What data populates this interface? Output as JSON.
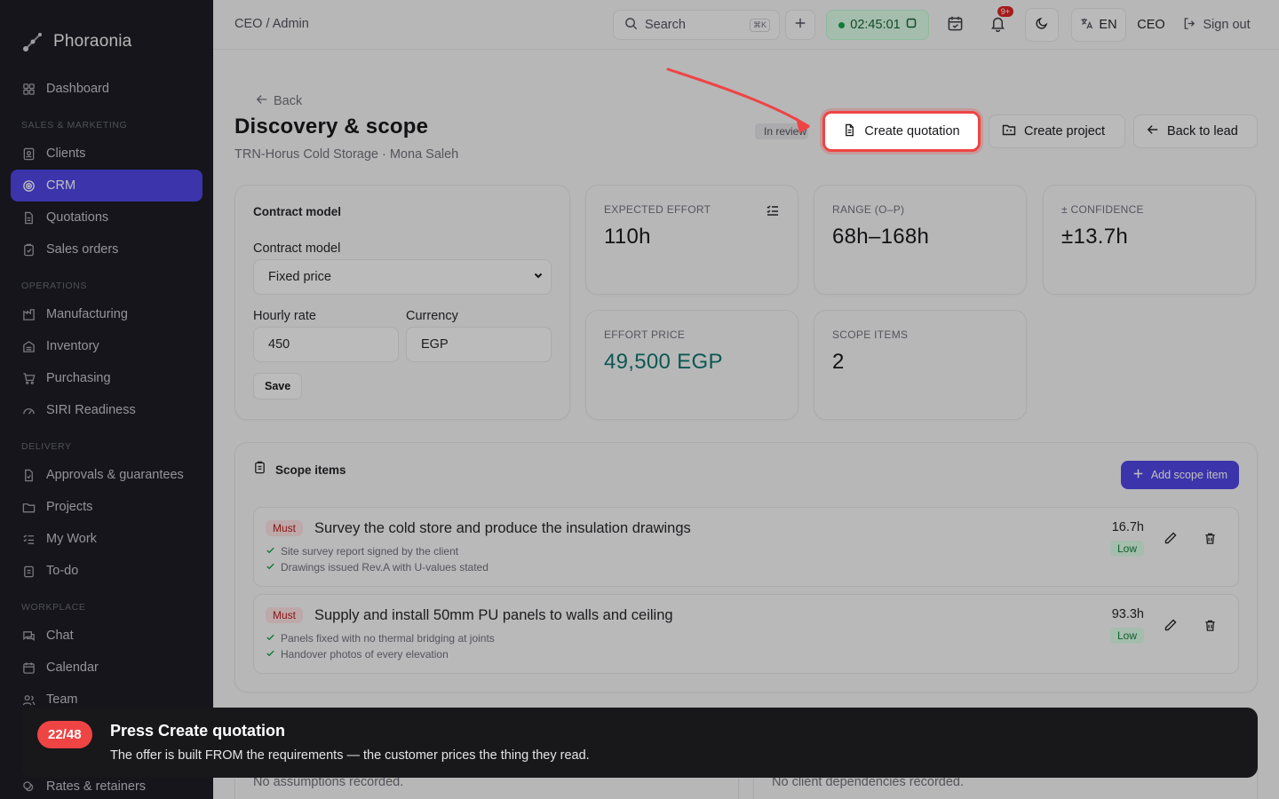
{
  "brand": {
    "name": "Phoraonia"
  },
  "sidebar": {
    "dashboard": "Dashboard",
    "sections": {
      "sales": "SALES & MARKETING",
      "operations": "OPERATIONS",
      "delivery": "DELIVERY",
      "workplace": "WORKPLACE"
    },
    "items": {
      "clients": "Clients",
      "crm": "CRM",
      "quotations": "Quotations",
      "sales_orders": "Sales orders",
      "manufacturing": "Manufacturing",
      "inventory": "Inventory",
      "purchasing": "Purchasing",
      "siri": "SIRI Readiness",
      "approvals": "Approvals & guarantees",
      "projects": "Projects",
      "mywork": "My Work",
      "todo": "To-do",
      "chat": "Chat",
      "calendar": "Calendar",
      "team": "Team",
      "rates": "Rates & retainers"
    }
  },
  "topbar": {
    "breadcrumb": "CEO / Admin",
    "search_label": "Search",
    "search_kbd": "⌘K",
    "timer": "02:45:01",
    "notif_badge": "9+",
    "language": "EN",
    "role": "CEO",
    "signout": "Sign out"
  },
  "page": {
    "back": "Back",
    "title": "Discovery & scope",
    "subtitle": "TRN-Horus Cold Storage · Mona Saleh",
    "status": "In review",
    "btn_quote": "Create quotation",
    "btn_project": "Create project",
    "btn_lead": "Back to lead"
  },
  "contract": {
    "heading": "Contract model",
    "model_label": "Contract model",
    "model_value": "Fixed price",
    "rate_label": "Hourly rate",
    "rate_value": "450",
    "currency_label": "Currency",
    "currency_value": "EGP",
    "save": "Save"
  },
  "stats": {
    "effort_label": "EXPECTED EFFORT",
    "effort_value": "110h",
    "range_label": "RANGE (O–P)",
    "range_value": "68h–168h",
    "confidence_label": "± CONFIDENCE",
    "confidence_value": "±13.7h",
    "price_label": "EFFORT PRICE",
    "price_value": "49,500 EGP",
    "items_label": "SCOPE ITEMS",
    "items_value": "2"
  },
  "colors": {
    "accent": "#4f46e5",
    "highlight": "#ef4444",
    "price": "#0f766e"
  },
  "scope": {
    "heading": "Scope items",
    "add": "Add scope item",
    "items": [
      {
        "priority": "Must",
        "title": "Survey the cold store and produce the insulation drawings",
        "criteria": [
          "Site survey report signed by the client",
          "Drawings issued Rev.A with U-values stated"
        ],
        "hours": "16.7h",
        "risk": "Low"
      },
      {
        "priority": "Must",
        "title": "Supply and install 50mm PU panels to walls and ceiling",
        "criteria": [
          "Panels fixed with no thermal bridging at joints",
          "Handover photos of every elevation"
        ],
        "hours": "93.3h",
        "risk": "Low"
      }
    ]
  },
  "bottom": {
    "assumptions_empty": "No assumptions recorded.",
    "client_deps_empty": "No client dependencies recorded."
  },
  "tour": {
    "step": "22/48",
    "title": "Press Create quotation",
    "body": "The offer is built FROM the requirements — the customer prices the thing they read."
  }
}
